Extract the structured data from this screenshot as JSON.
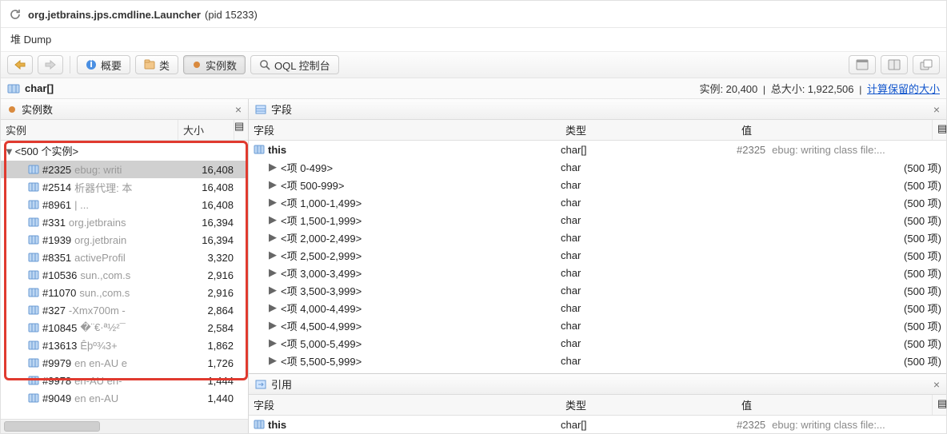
{
  "window": {
    "app": "org.jetbrains.jps.cmdline.Launcher",
    "pid": "(pid 15233)",
    "dump": "堆 Dump"
  },
  "toolbar": {
    "overview": "概要",
    "classes": "类",
    "instances": "实例数",
    "oql": "OQL 控制台"
  },
  "context": {
    "class": "char[]",
    "instance_lbl": "实例:",
    "instance_val": "20,400",
    "total_lbl": "总大小:",
    "total_val": "1,922,506",
    "retained": "计算保留的大小"
  },
  "left": {
    "tab": "实例数",
    "col_instance": "实例",
    "col_size": "大小",
    "group": "<500 个实例>",
    "rows": [
      {
        "id": "#2325",
        "desc": "ebug: writi",
        "size": "16,408",
        "sel": true
      },
      {
        "id": "#2514",
        "desc": "析器代理: 本",
        "size": "16,408"
      },
      {
        "id": "#8961",
        "desc": " | ...",
        "size": "16,408"
      },
      {
        "id": "#331",
        "desc": "org.jetbrains",
        "size": "16,394"
      },
      {
        "id": "#1939",
        "desc": "org.jetbrain",
        "size": "16,394"
      },
      {
        "id": "#8351",
        "desc": "activeProfil",
        "size": "3,320"
      },
      {
        "id": "#10536",
        "desc": "sun.,com.s",
        "size": "2,916"
      },
      {
        "id": "#11070",
        "desc": "sun.,com.s",
        "size": "2,916"
      },
      {
        "id": "#327",
        "desc": "-Xmx700m -",
        "size": "2,864"
      },
      {
        "id": "#10845",
        "desc": "�¨€·ª½²¯",
        "size": "2,584"
      },
      {
        "id": "#13613",
        "desc": "Êþº¾3+",
        "size": "1,862"
      },
      {
        "id": "#9979",
        "desc": "en en-AU e",
        "size": "1,726"
      },
      {
        "id": "#9978",
        "desc": "en-AU en-",
        "size": "1,444"
      },
      {
        "id": "#9049",
        "desc": "en en-AU",
        "size": "1,440"
      }
    ]
  },
  "fields": {
    "tab": "字段",
    "col_field": "字段",
    "col_type": "类型",
    "col_value": "值",
    "this": "this",
    "this_type": "char[]",
    "this_hash": "#2325",
    "this_val": "ebug: writing class file:...",
    "ranges": [
      "<项 0-499>",
      "<项 500-999>",
      "<项 1,000-1,499>",
      "<项 1,500-1,999>",
      "<项 2,000-2,499>",
      "<项 2,500-2,999>",
      "<项 3,000-3,499>",
      "<项 3,500-3,999>",
      "<项 4,000-4,499>",
      "<项 4,500-4,999>",
      "<项 5,000-5,499>",
      "<项 5,500-5,999>"
    ],
    "range_type": "char",
    "range_count": "(500 项)"
  },
  "refs": {
    "tab": "引用",
    "col_field": "字段",
    "col_type": "类型",
    "col_value": "值",
    "this": "this",
    "this_type": "char[]",
    "this_hash": "#2325",
    "this_val": "ebug: writing class file:..."
  }
}
